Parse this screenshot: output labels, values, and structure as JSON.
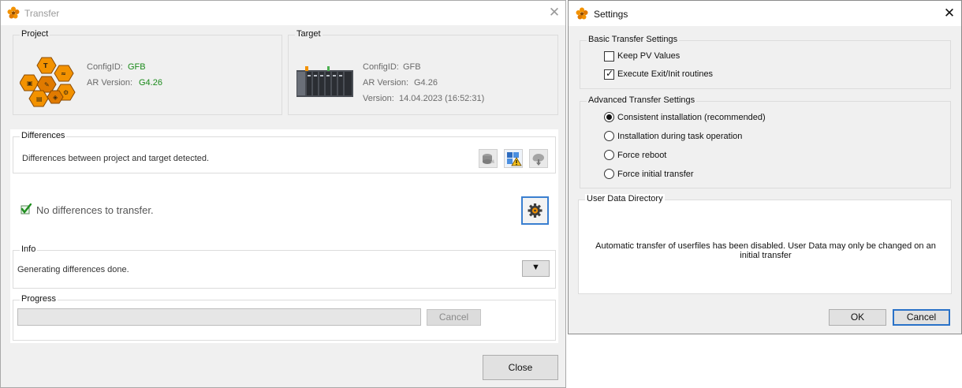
{
  "transfer_window": {
    "title": "Transfer",
    "close_glyph": "✕",
    "project": {
      "group_label": "Project",
      "config_id_label": "ConfigID:",
      "config_id_value": "GFB",
      "ar_version_label": "AR Version:",
      "ar_version_value": "G4.26",
      "image_icon": "project-logo-icon"
    },
    "target": {
      "group_label": "Target",
      "config_id_label": "ConfigID:",
      "config_id_value": "GFB",
      "ar_version_label": "AR Version:",
      "ar_version_value": "G4.26",
      "version_label": "Version:",
      "version_value": "14.04.2023 (16:52:31)",
      "image_icon": "plc-hardware-icon"
    },
    "differences": {
      "group_label": "Differences",
      "message": "Differences between project and target detected.",
      "status_text": "No differences to transfer.",
      "status_icon": "green-check-icon"
    },
    "info": {
      "group_label": "Info",
      "message": "Generating differences done.",
      "dropdown_glyph": "▼"
    },
    "progress": {
      "group_label": "Progress",
      "cancel_label": "Cancel",
      "value": 0
    },
    "close_label": "Close",
    "colors": {
      "green_value": "#1a8a1a",
      "accent_blue": "#2a72c8",
      "brand_orange": "#f39200"
    }
  },
  "settings_window": {
    "title": "Settings",
    "close_glyph": "✕",
    "basic": {
      "group_label": "Basic Transfer Settings",
      "options": [
        {
          "label": "Keep PV Values",
          "checked": false
        },
        {
          "label": "Execute Exit/Init routines",
          "checked": true
        }
      ]
    },
    "advanced": {
      "group_label": "Advanced Transfer Settings",
      "options": [
        {
          "label": "Consistent  installation (recommended)",
          "selected": true
        },
        {
          "label": "Installation during task operation",
          "selected": false
        },
        {
          "label": "Force reboot",
          "selected": false
        },
        {
          "label": "Force initial transfer",
          "selected": false
        }
      ]
    },
    "user_data": {
      "group_label": "User Data Directory",
      "message_line1": "Automatic transfer of userfiles has been disabled. User Data may only be changed  on an",
      "message_line2": "initial transfer"
    },
    "ok_label": "OK",
    "cancel_label": "Cancel"
  }
}
